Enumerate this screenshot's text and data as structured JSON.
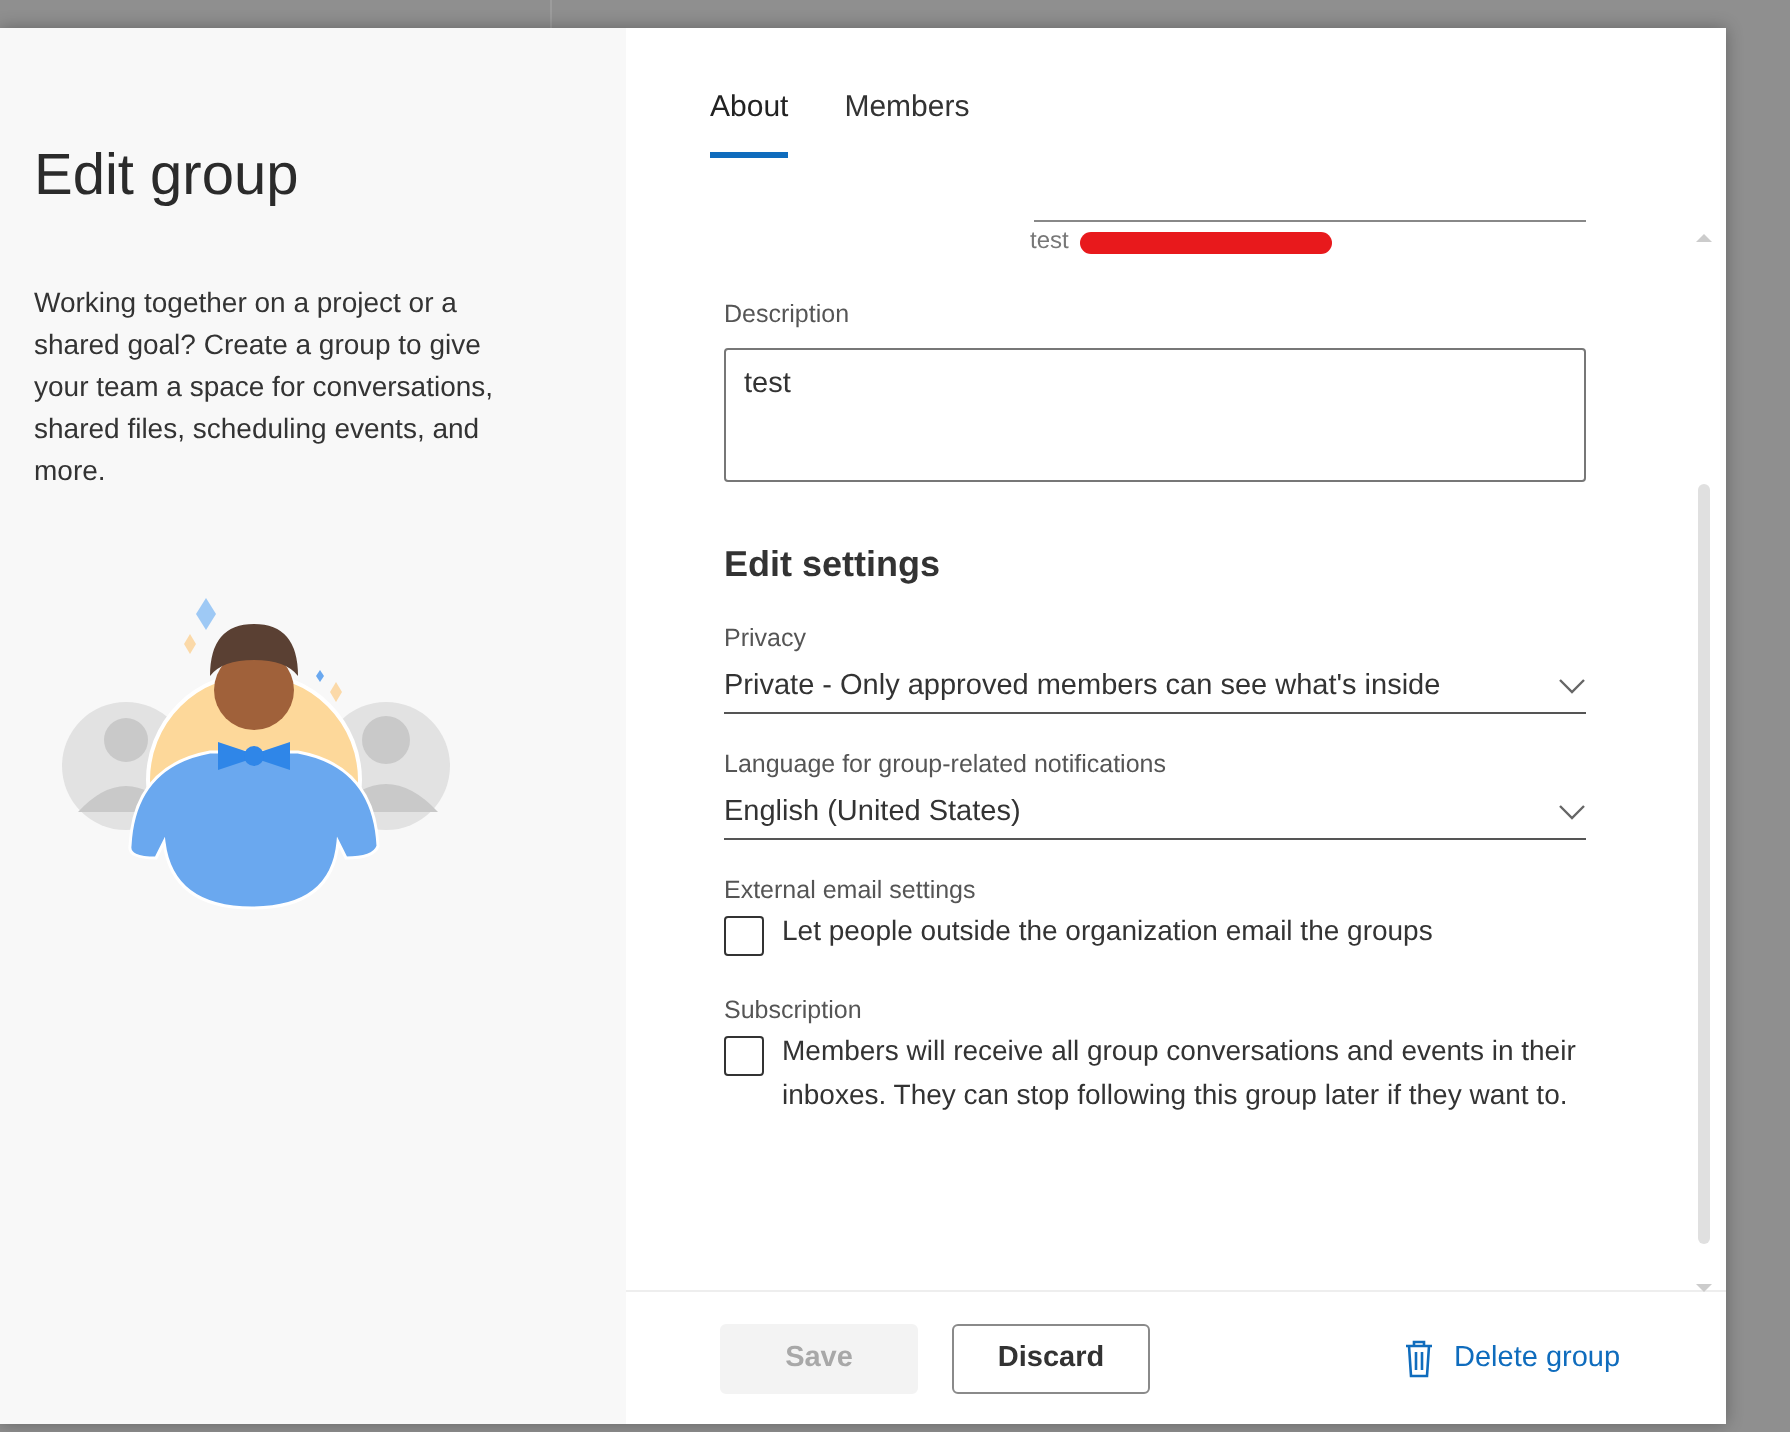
{
  "dialog": {
    "title": "Edit group",
    "intro": "Working together on a project or a shared goal? Create a group to give your team a space for conversations, shared files, scheduling events, and more.",
    "tabs": [
      {
        "label": "About",
        "selected": true
      },
      {
        "label": "Members",
        "selected": false
      }
    ],
    "email": {
      "value": "test",
      "redacted": true
    },
    "description": {
      "label": "Description",
      "value": "test"
    },
    "settings_heading": "Edit settings",
    "dropdowns": [
      {
        "label": "Privacy",
        "value": "Private - Only approved members can see what's inside"
      },
      {
        "label": "Language for group-related notifications",
        "value": "English (United States)"
      }
    ],
    "checkboxes": [
      {
        "label": "External email settings",
        "text": "Let people outside the organization email the groups",
        "checked": false
      },
      {
        "label": "Subscription",
        "text": "Members will receive all group conversations and events in their inboxes. They can stop following this group later if they want to.",
        "checked": false
      }
    ],
    "footer": {
      "save": {
        "label": "Save",
        "disabled": true
      },
      "discard": {
        "label": "Discard"
      },
      "delete": {
        "label": "Delete group"
      }
    }
  }
}
